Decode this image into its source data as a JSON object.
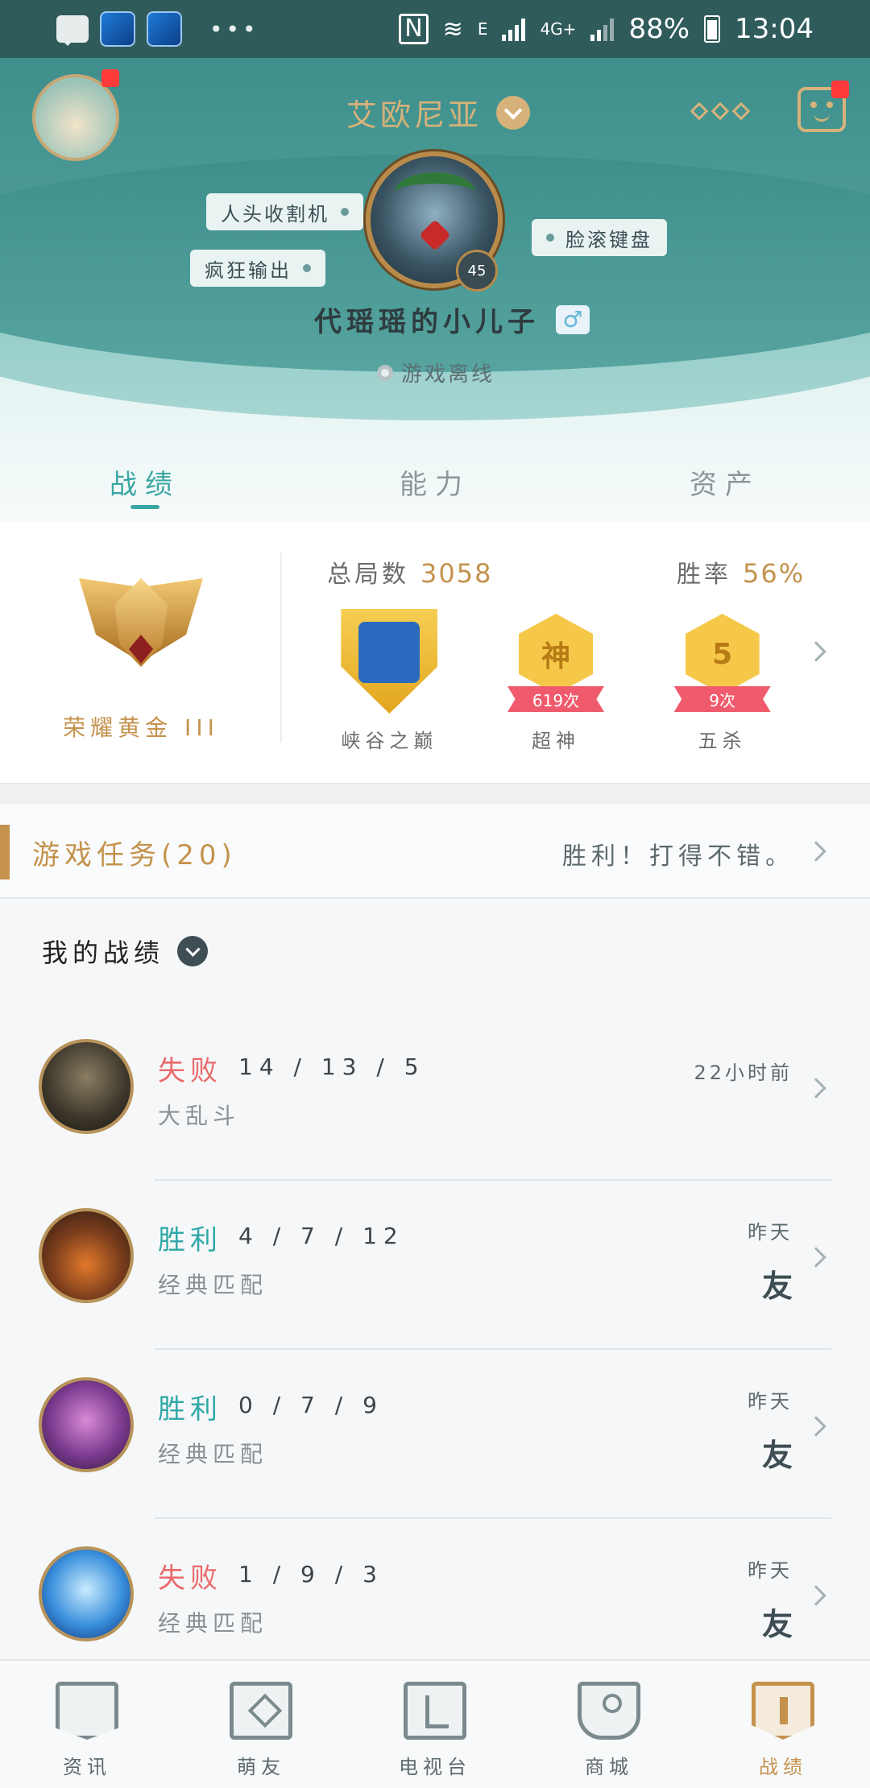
{
  "status_bar": {
    "network_e": "E",
    "network_4g": "4G+",
    "battery": "88%",
    "time": "13:04"
  },
  "header": {
    "server": "艾欧尼亚",
    "level": "45",
    "tags": [
      "人头收割机",
      "疯狂输出",
      "脸滚键盘"
    ],
    "nickname": "代瑶瑶的小儿子",
    "gender_symbol": "♂",
    "status": "游戏离线",
    "accent_color": "#3aa6a2",
    "gold_color": "#c4924d"
  },
  "tabs": [
    {
      "label": "战绩",
      "active": true
    },
    {
      "label": "能力",
      "active": false
    },
    {
      "label": "资产",
      "active": false
    }
  ],
  "stats": {
    "rank_name": "荣耀黄金 III",
    "total_games_label": "总局数",
    "total_games": "3058",
    "win_rate_label": "胜率",
    "win_rate": "56%",
    "badges": [
      {
        "name": "峡谷之巅",
        "count": ""
      },
      {
        "name": "超神",
        "count": "619次",
        "glyph": "神"
      },
      {
        "name": "五杀",
        "count": "9次",
        "glyph": "5"
      }
    ]
  },
  "tasks": {
    "title": "游戏任务(20)",
    "message": "胜利！打得不错。"
  },
  "history": {
    "title": "我的战绩",
    "matches": [
      {
        "result": "失败",
        "outcome": "loss",
        "kda": "14 / 13 / 5",
        "mode": "大乱斗",
        "time": "22小时前",
        "friend": ""
      },
      {
        "result": "胜利",
        "outcome": "win",
        "kda": "4 / 7 / 12",
        "mode": "经典匹配",
        "time": "昨天",
        "friend": "友"
      },
      {
        "result": "胜利",
        "outcome": "win",
        "kda": "0 / 7 / 9",
        "mode": "经典匹配",
        "time": "昨天",
        "friend": "友"
      },
      {
        "result": "失败",
        "outcome": "loss",
        "kda": "1 / 9 / 3",
        "mode": "经典匹配",
        "time": "昨天",
        "friend": "友"
      }
    ]
  },
  "bottom_nav": [
    {
      "label": "资讯",
      "icon": "news-icon",
      "active": false
    },
    {
      "label": "萌友",
      "icon": "chat-heart-icon",
      "active": false
    },
    {
      "label": "电视台",
      "icon": "tv-icon",
      "active": false
    },
    {
      "label": "商城",
      "icon": "shop-bag-icon",
      "active": false
    },
    {
      "label": "战绩",
      "icon": "record-shield-icon",
      "active": true
    }
  ]
}
